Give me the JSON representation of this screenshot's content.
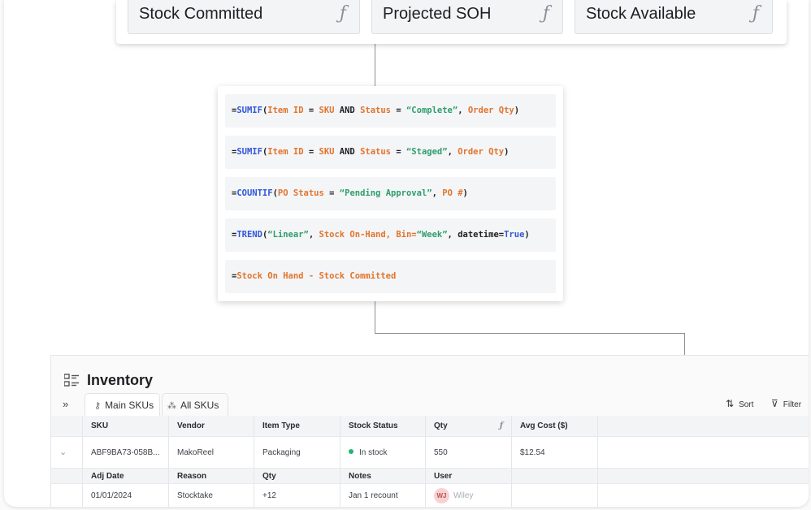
{
  "fields": [
    {
      "label": "Stock Committed",
      "icon": "function-icon"
    },
    {
      "label": "Projected SOH",
      "icon": "function-icon"
    },
    {
      "label": "Stock Available",
      "icon": "function-icon"
    }
  ],
  "formulas": [
    {
      "tokens": [
        {
          "t": "=",
          "c": "k"
        },
        {
          "t": "SUMIF",
          "c": "fn"
        },
        {
          "t": "(",
          "c": "k"
        },
        {
          "t": "Item ID",
          "c": "fd"
        },
        {
          "t": " = ",
          "c": "k"
        },
        {
          "t": "SKU",
          "c": "fd"
        },
        {
          "t": " AND ",
          "c": "k"
        },
        {
          "t": "Status",
          "c": "fd"
        },
        {
          "t": " = ",
          "c": "k"
        },
        {
          "t": "“Complete”",
          "c": "st"
        },
        {
          "t": ", ",
          "c": "k"
        },
        {
          "t": "Order Qty",
          "c": "fd"
        },
        {
          "t": ")",
          "c": "k"
        }
      ]
    },
    {
      "tokens": [
        {
          "t": "=",
          "c": "k"
        },
        {
          "t": "SUMIF",
          "c": "fn"
        },
        {
          "t": "(",
          "c": "k"
        },
        {
          "t": "Item ID",
          "c": "fd"
        },
        {
          "t": " = ",
          "c": "k"
        },
        {
          "t": "SKU",
          "c": "fd"
        },
        {
          "t": " AND ",
          "c": "k"
        },
        {
          "t": "Status",
          "c": "fd"
        },
        {
          "t": " = ",
          "c": "k"
        },
        {
          "t": "“Staged”",
          "c": "st"
        },
        {
          "t": ", ",
          "c": "k"
        },
        {
          "t": "Order Qty",
          "c": "fd"
        },
        {
          "t": ")",
          "c": "k"
        }
      ]
    },
    {
      "tokens": [
        {
          "t": "=",
          "c": "k"
        },
        {
          "t": "COUNTIF",
          "c": "fn"
        },
        {
          "t": "(",
          "c": "k"
        },
        {
          "t": "PO Status",
          "c": "fd"
        },
        {
          "t": " = ",
          "c": "k"
        },
        {
          "t": "“Pending Approval”",
          "c": "st"
        },
        {
          "t": ", ",
          "c": "k"
        },
        {
          "t": "PO #",
          "c": "fd"
        },
        {
          "t": ")",
          "c": "k"
        }
      ]
    },
    {
      "tokens": [
        {
          "t": "=",
          "c": "k"
        },
        {
          "t": "TREND",
          "c": "fn"
        },
        {
          "t": "(",
          "c": "k"
        },
        {
          "t": "“Linear”",
          "c": "st"
        },
        {
          "t": ", ",
          "c": "k"
        },
        {
          "t": "Stock On-Hand, Bin=",
          "c": "fd"
        },
        {
          "t": "“Week”",
          "c": "st"
        },
        {
          "t": ", ",
          "c": "k"
        },
        {
          "t": "datetime=",
          "c": "k"
        },
        {
          "t": "True",
          "c": "fn"
        },
        {
          "t": ")",
          "c": "k"
        }
      ]
    },
    {
      "tokens": [
        {
          "t": "=",
          "c": "k"
        },
        {
          "t": "Stock On Hand - Stock Committed",
          "c": "fd"
        }
      ]
    }
  ],
  "inventory": {
    "title": "Inventory",
    "collapse_label": "»",
    "tabs": [
      {
        "label": "Main SKUs",
        "icon": "key-icon",
        "active": true
      },
      {
        "label": "All SKUs",
        "icon": "tree-icon",
        "active": false
      }
    ],
    "sort_label": "Sort",
    "filter_label": "Filter",
    "columns": [
      "SKU",
      "Vendor",
      "Item Type",
      "Stock Status",
      "Qty",
      "Avg Cost ($)"
    ],
    "row": {
      "sku": "ABF9BA73-058B...",
      "vendor": "MakoReel",
      "item_type": "Packaging",
      "stock_status": "In stock",
      "qty": "550",
      "avg_cost": "$12.54"
    },
    "sub_columns": [
      "Adj Date",
      "Reason",
      "Qty",
      "Notes",
      "User"
    ],
    "sub_row": {
      "adj_date": "01/01/2024",
      "reason": "Stocktake",
      "qty": "+12",
      "notes": "Jan 1 recount",
      "user_initials": "WJ",
      "user_name": "Wiley"
    }
  }
}
